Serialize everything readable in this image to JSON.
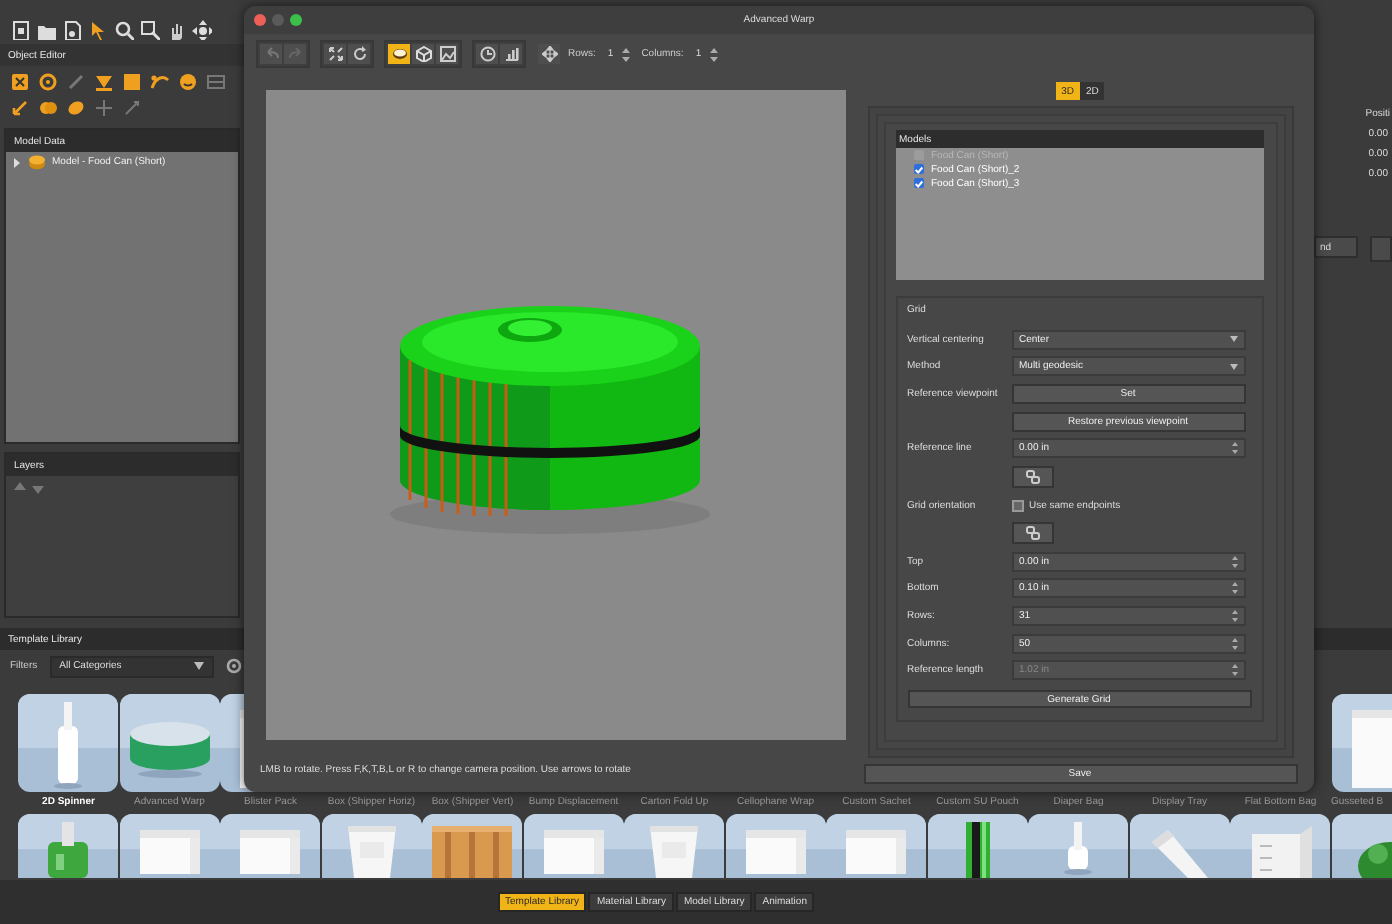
{
  "app": {
    "object_editor": {
      "title": "Object Editor"
    },
    "model_data": {
      "title": "Model Data",
      "items": [
        {
          "label": "Model - Food Can (Short)",
          "expanded": false
        }
      ]
    },
    "layers": {
      "title": "Layers"
    },
    "inspector": {
      "heading": "Positi",
      "values": [
        "0.00",
        "0.00",
        "0.00"
      ],
      "button": "nd"
    },
    "template_library": {
      "title": "Template Library",
      "filter_label": "Filters",
      "filter_value": "All Categories",
      "templates": [
        {
          "label": "2D Spinner",
          "selected": true,
          "kind": "picture"
        },
        {
          "label": "Advanced Warp",
          "selected": false,
          "kind": "picture"
        },
        {
          "label": "Blister Pack",
          "selected": false,
          "kind": "picture"
        },
        {
          "label": "Box (Shipper Horiz)",
          "selected": false
        },
        {
          "label": "Box (Shipper Vert)",
          "selected": false
        },
        {
          "label": "Bump Displacement",
          "selected": false
        },
        {
          "label": "Carton Fold Up",
          "selected": false
        },
        {
          "label": "Cellophane Wrap",
          "selected": false
        },
        {
          "label": "Custom Sachet",
          "selected": false
        },
        {
          "label": "Custom SU Pouch",
          "selected": false
        },
        {
          "label": "Diaper Bag",
          "selected": false
        },
        {
          "label": "Display Tray",
          "selected": false
        },
        {
          "label": "Flat Bottom Bag",
          "selected": false
        },
        {
          "label": "Gusseted B",
          "selected": false,
          "kind": "picture"
        }
      ]
    },
    "bottom_tabs": [
      {
        "label": "Template Library",
        "selected": true
      },
      {
        "label": "Material Library",
        "selected": false
      },
      {
        "label": "Model Library",
        "selected": false
      },
      {
        "label": "Animation",
        "selected": false
      }
    ]
  },
  "dialog": {
    "title": "Advanced Warp",
    "view_modes": [
      {
        "selected": true
      },
      {
        "selected": false
      },
      {
        "selected": false
      }
    ],
    "rows": {
      "label": "Rows:",
      "value": "1"
    },
    "columns": {
      "label": "Columns:",
      "value": "1"
    },
    "hint": "LMB to rotate. Press F,K,T,B,L or R to change camera position. Use arrows to rotate",
    "dimension_tabs": [
      {
        "label": "3D",
        "selected": true
      },
      {
        "label": "2D",
        "selected": false
      }
    ],
    "models": {
      "title": "Models",
      "items": [
        {
          "label": "Food Can (Short)",
          "checked": false,
          "disabled": true
        },
        {
          "label": "Food Can (Short)_2",
          "checked": true,
          "disabled": false
        },
        {
          "label": "Food Can (Short)_3",
          "checked": true,
          "disabled": false
        }
      ]
    },
    "grid": {
      "title": "Grid",
      "fields": [
        {
          "kind": "dropdown",
          "label": "Vertical centering",
          "value": "Center"
        },
        {
          "kind": "dropdown",
          "label": "Method",
          "value": "Multi geodesic"
        },
        {
          "kind": "button",
          "label": "Reference viewpoint",
          "value": "Set"
        },
        {
          "kind": "button",
          "value": "Restore previous viewpoint"
        },
        {
          "kind": "spin",
          "label": "Reference line",
          "value": "0.00 in",
          "disabled": false
        },
        {
          "kind": "icon_button"
        },
        {
          "kind": "checkbox",
          "label": "Grid orientation",
          "value": "Use same endpoints",
          "checked": false
        },
        {
          "kind": "icon_button"
        },
        {
          "kind": "spin",
          "label": "Top",
          "value": "0.00 in",
          "disabled": false
        },
        {
          "kind": "spin",
          "label": "Bottom",
          "value": "0.10 in",
          "disabled": false
        },
        {
          "kind": "spin",
          "label": "Rows:",
          "value": "31",
          "disabled": false
        },
        {
          "kind": "spin",
          "label": "Columns:",
          "value": "50",
          "disabled": false
        },
        {
          "kind": "spin",
          "label": "Reference length",
          "value": "1.02 in",
          "disabled": true
        }
      ],
      "generate": "Generate Grid"
    },
    "save": "Save"
  }
}
